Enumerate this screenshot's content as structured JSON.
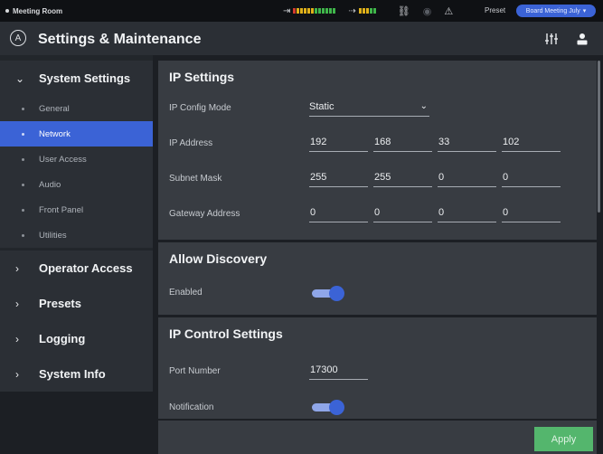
{
  "status": {
    "room": "Meeting Room",
    "preset_label": "Preset",
    "preset_name": "Board Meeting July"
  },
  "header": {
    "title": "Settings & Maintenance"
  },
  "sidebar": {
    "groups": [
      {
        "label": "System Settings",
        "expanded": true
      },
      {
        "label": "Operator Access"
      },
      {
        "label": "Presets"
      },
      {
        "label": "Logging"
      },
      {
        "label": "System Info"
      }
    ],
    "subitems": [
      "General",
      "Network",
      "User Access",
      "Audio",
      "Front Panel",
      "Utilities"
    ],
    "active_subitem": "Network"
  },
  "ip_settings": {
    "title": "IP Settings",
    "config_mode_label": "IP Config Mode",
    "config_mode_value": "Static",
    "ip_address_label": "IP Address",
    "ip_address": [
      "192",
      "168",
      "33",
      "102"
    ],
    "subnet_label": "Subnet Mask",
    "subnet": [
      "255",
      "255",
      "0",
      "0"
    ],
    "gateway_label": "Gateway Address",
    "gateway": [
      "0",
      "0",
      "0",
      "0"
    ]
  },
  "discovery": {
    "title": "Allow Discovery",
    "enabled_label": "Enabled",
    "enabled": true
  },
  "ip_control": {
    "title": "IP Control Settings",
    "port_label": "Port Number",
    "port_value": "17300",
    "notification_label": "Notification",
    "notification": true
  },
  "footer": {
    "apply_label": "Apply"
  },
  "colors": {
    "accent": "#3b63d6",
    "apply": "#54b66d"
  }
}
